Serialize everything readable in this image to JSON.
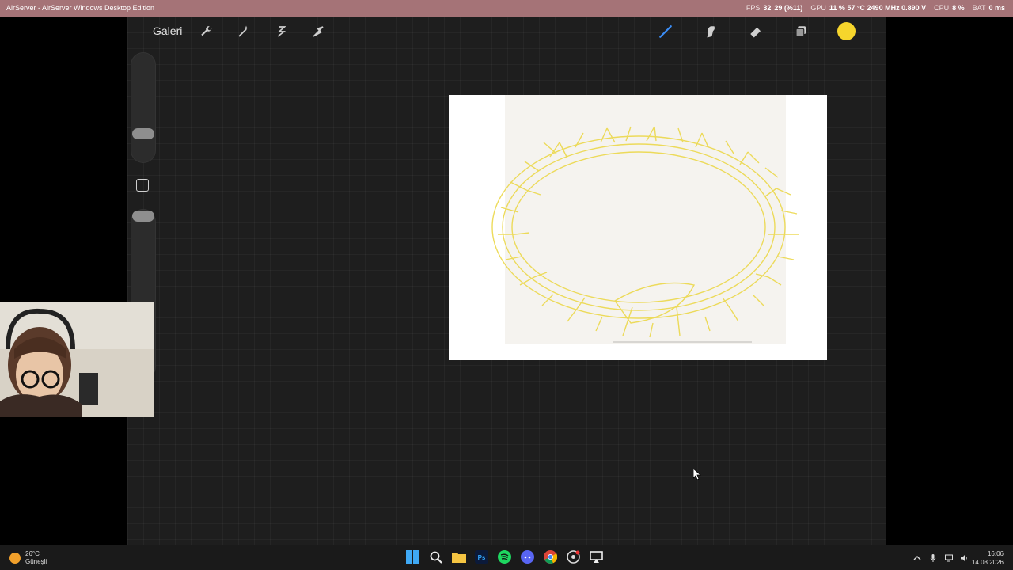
{
  "window": {
    "title": "AirServer - AirServer Windows Desktop Edition"
  },
  "perf": {
    "fps_label": "FPS",
    "fps_value": "32",
    "fps_extra": "29 (%11)",
    "gpu_label": "GPU",
    "gpu_value": "11 % 57 °C 2490 MHz 0.890 V",
    "cpu_label": "CPU",
    "cpu_value": "8 %",
    "bat_label": "BAT",
    "bat_value": "0 ms"
  },
  "toolbar": {
    "gallery_label": "Galeri",
    "tools_left": [
      "wrench-icon",
      "magic-wand-icon",
      "selection-icon",
      "transform-arrow-icon"
    ],
    "tools_right": [
      "brush-icon",
      "smudge-icon",
      "eraser-icon",
      "layers-icon"
    ],
    "current_color": "#f6d52c"
  },
  "taskbar": {
    "weather_temp": "26°C",
    "weather_desc": "Güneşli",
    "apps": [
      "windows-start-icon",
      "search-icon",
      "file-explorer-icon",
      "photoshop-icon",
      "spotify-icon",
      "discord-icon",
      "chrome-icon",
      "obs-icon",
      "airserver-icon"
    ],
    "photoshop_label": "Ps",
    "time": "16:06",
    "date": "14.08.2026"
  }
}
